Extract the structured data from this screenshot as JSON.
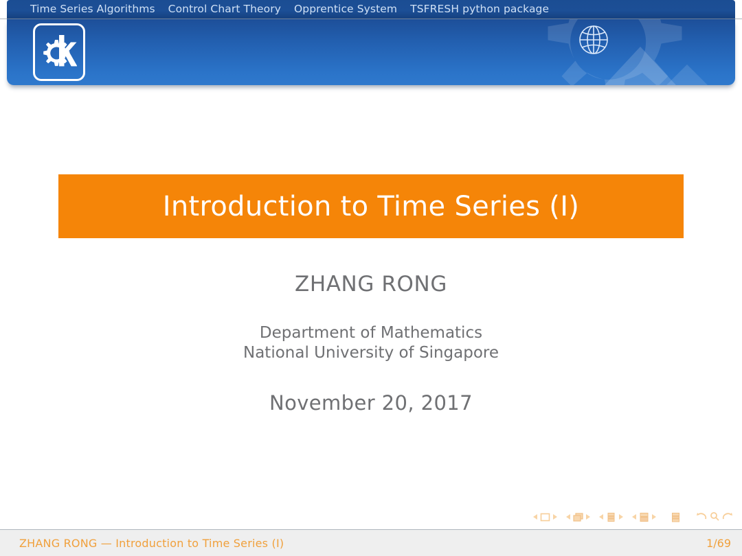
{
  "theme": {
    "accent_orange": "#f58508",
    "footer_orange": "#f0a03c",
    "header_blue_top": "#1d4f99",
    "header_blue_bottom": "#2f79cd",
    "navbar_blue": "#1b4d93",
    "nav_text": "#cfe0f5",
    "body_text_gray": "#6f7073",
    "footer_bg": "#efefef"
  },
  "navbar": {
    "items": [
      {
        "label": "Time Series Algorithms"
      },
      {
        "label": "Control Chart Theory"
      },
      {
        "label": "Opprentice System"
      },
      {
        "label": "TSFRESH python package"
      }
    ]
  },
  "header": {
    "logo_icon": "kde-gear-k-logo",
    "globe_icon": "globe-icon",
    "watermark_icon": "cog-watermark"
  },
  "title_slide": {
    "title": "Introduction to Time Series (I)",
    "author": "ZHANG RONG",
    "affiliation_line1": "Department of Mathematics",
    "affiliation_line2": "National University of Singapore",
    "date": "November 20, 2017"
  },
  "nav_symbols": {
    "groups": [
      {
        "icon": "slide-icon",
        "prev": "prev-slide-arrow",
        "next": "next-slide-arrow"
      },
      {
        "icon": "frame-icon",
        "prev": "prev-frame-arrow",
        "next": "next-frame-arrow"
      },
      {
        "icon": "subsection-icon",
        "prev": "prev-subsection-arrow",
        "next": "next-subsection-arrow"
      },
      {
        "icon": "section-icon",
        "prev": "prev-section-arrow",
        "next": "next-section-arrow"
      }
    ],
    "doc_icon": "document-icon",
    "back_icon": "back-arrow-icon",
    "search_icon": "search-icon",
    "forward_icon": "forward-arrow-icon"
  },
  "footer": {
    "left": "ZHANG RONG — Introduction to Time Series (I)",
    "page": "1/69"
  }
}
